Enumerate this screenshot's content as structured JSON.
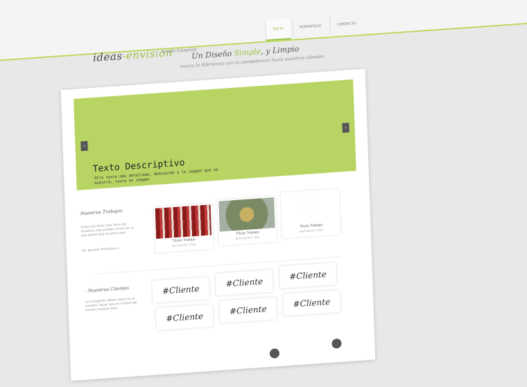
{
  "browser": {
    "address": "ideas-envision"
  },
  "header": {
    "logo_main": "ideas",
    "logo_accent": "-envision",
    "tagline": "Simple Estephed",
    "nav": [
      {
        "label": "INICIO",
        "active": true
      },
      {
        "label": "PORTAFOLIO",
        "active": false
      },
      {
        "label": "CONTACTO",
        "active": false
      }
    ]
  },
  "hero": {
    "headline_pre": "Un Diseño ",
    "headline_hl": "Simple",
    "headline_post": ", y Limpio",
    "subline": "marca la diferencia con la competencia hacia nuestros clientes."
  },
  "slider": {
    "title": "Texto Descriptivo",
    "description": "Otro texto más detallado, deacuerdo a la imagen que se muestra, texto en imagen",
    "prev": "‹",
    "next": "›"
  },
  "works": {
    "label": "Nuestros Trabajos",
    "intro": "Estos son otros mas texto de muestra, que pueden incluir en lo que desee que muestra aqui.",
    "more": "Ver Nuestro Portafolio →",
    "items": [
      {
        "title": "Titulo Trabajo",
        "meta": "descripcion | foto"
      },
      {
        "title": "Titulo Trabajo",
        "meta": "descripcion | foto"
      },
      {
        "title": "Titulo Trabajo",
        "meta": "descripcion | foto"
      }
    ]
  },
  "clients": {
    "label": "Nuestros Clientes",
    "intro": "Los imagenes deben estar en el nombre, hacer que el nombre del cliente muestre esto.",
    "items": [
      "#Cliente",
      "#Cliente",
      "#Cliente",
      "#Cliente",
      "#Cliente",
      "#Cliente"
    ]
  },
  "colors": {
    "accent": "#9cc447",
    "slider": "#b8d564"
  }
}
